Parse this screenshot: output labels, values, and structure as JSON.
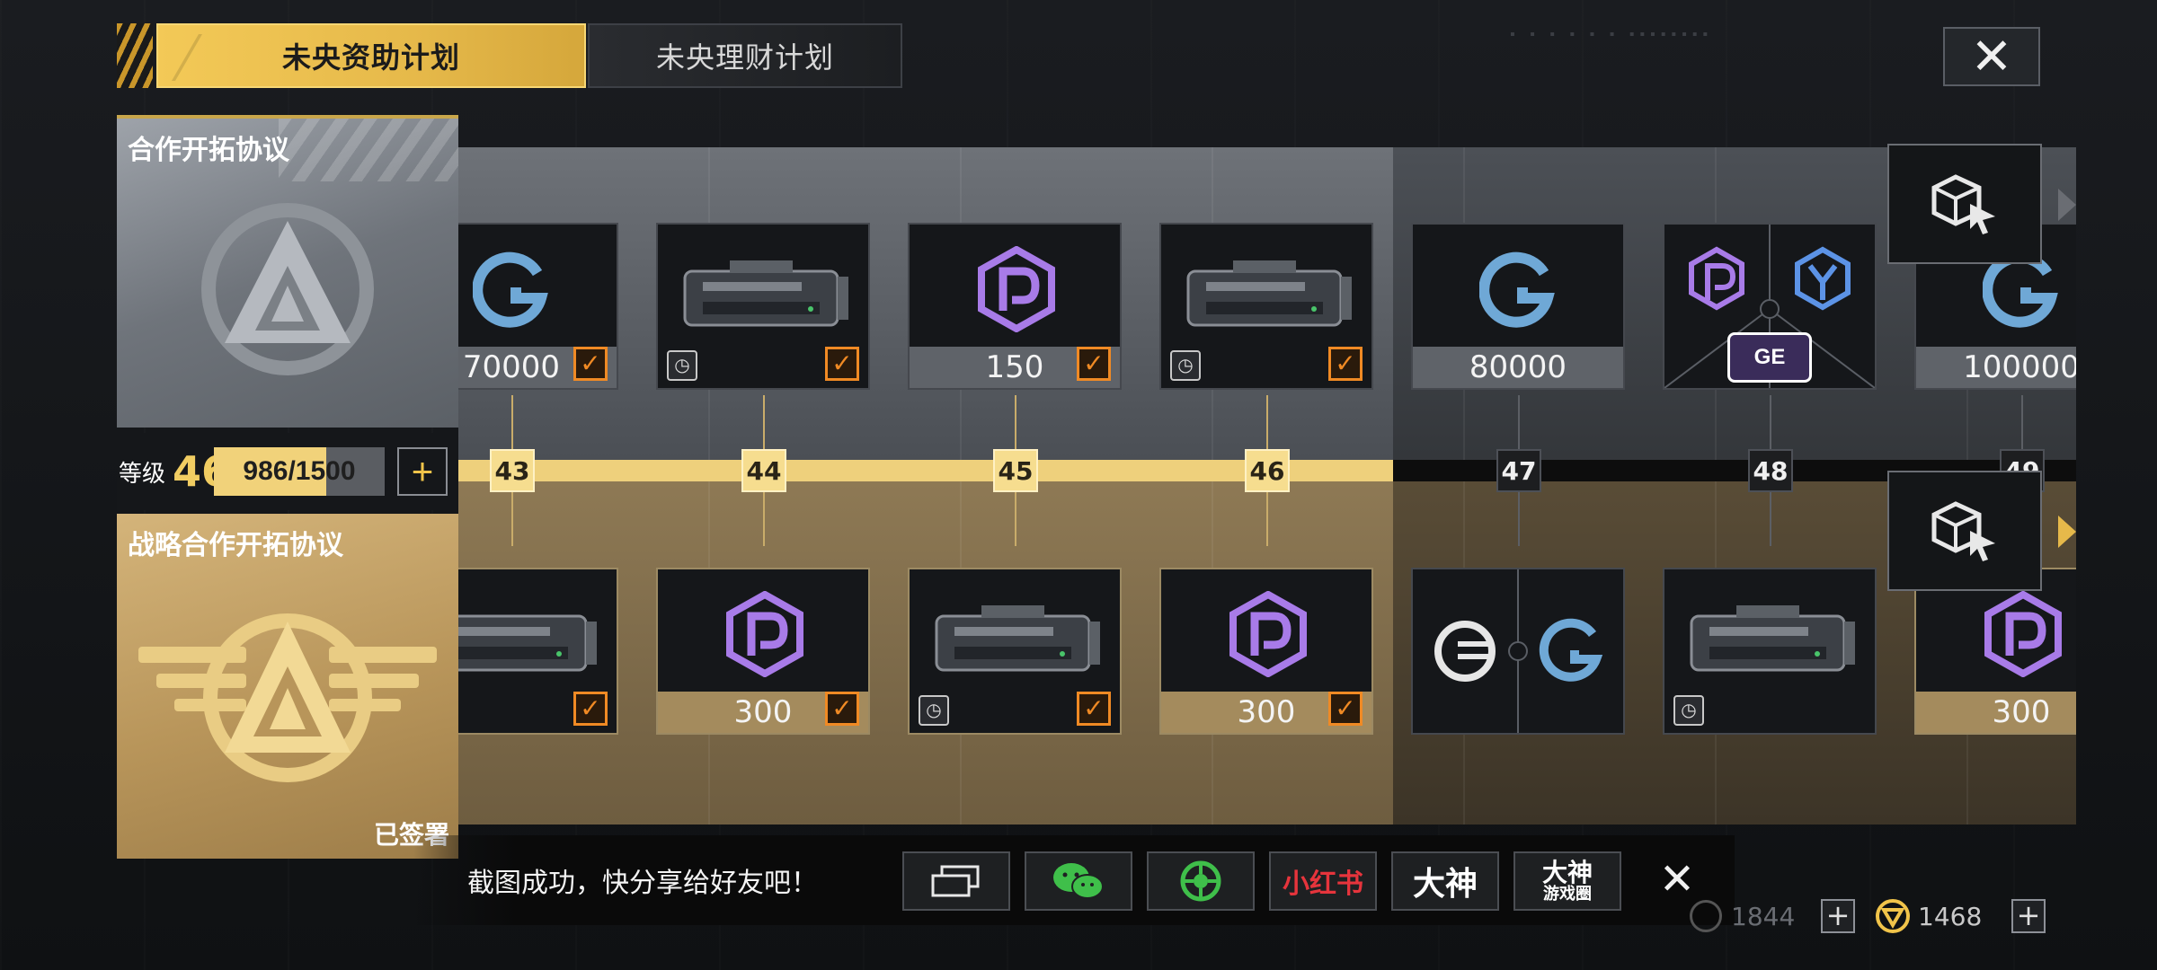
{
  "tabs": [
    {
      "label": "未央资助计划",
      "active": true
    },
    {
      "label": "未央理财计划",
      "active": false
    }
  ],
  "panels": {
    "free_title": "合作开拓协议",
    "premium_title": "战略合作开拓协议",
    "premium_status": "已签署"
  },
  "level": {
    "label": "等级",
    "value": "46",
    "progress_text": "986/1500",
    "progress_fraction": 0.657
  },
  "track": {
    "levels": [
      {
        "num": "43",
        "reached": true
      },
      {
        "num": "44",
        "reached": true
      },
      {
        "num": "45",
        "reached": true
      },
      {
        "num": "46",
        "reached": true
      },
      {
        "num": "47",
        "reached": false
      },
      {
        "num": "48",
        "reached": false
      },
      {
        "num": "49",
        "reached": false
      }
    ],
    "free_rewards": [
      {
        "icon": "coin-c-icon",
        "amount": "70000",
        "claimed": true
      },
      {
        "icon": "weapon-case-icon",
        "amount": "",
        "claimed": true,
        "timed": true
      },
      {
        "icon": "p-coin-icon",
        "amount": "150",
        "claimed": true
      },
      {
        "icon": "weapon-case-icon",
        "amount": "",
        "claimed": true,
        "timed": true
      },
      {
        "icon": "coin-c-icon",
        "amount": "80000",
        "claimed": false
      },
      {
        "icon": "choice-pack-icon",
        "amount": "",
        "claimed": false,
        "badge": "GE"
      },
      {
        "icon": "coin-c-icon",
        "amount": "100000",
        "claimed": false
      }
    ],
    "premium_rewards": [
      {
        "icon": "weapon-case-icon",
        "amount": "",
        "claimed": true
      },
      {
        "icon": "p-coin-icon",
        "amount": "300",
        "claimed": true
      },
      {
        "icon": "weapon-case-icon",
        "amount": "",
        "claimed": true,
        "timed": true
      },
      {
        "icon": "p-coin-icon",
        "amount": "300",
        "claimed": true
      },
      {
        "icon": "dual-coin-icon",
        "amount": "",
        "claimed": false
      },
      {
        "icon": "weapon-case-icon",
        "amount": "",
        "claimed": false,
        "timed": true
      },
      {
        "icon": "p-coin-icon",
        "amount": "300",
        "claimed": false
      }
    ]
  },
  "share": {
    "message": "截图成功，快分享给好友吧！",
    "buttons": [
      "screenshot-icon",
      "wechat-icon",
      "moments-icon",
      "小红书",
      "大神",
      "大神游戏圈"
    ],
    "btn_xhs": "小红书",
    "btn_dashen": "大神",
    "btn_dashen_line1": "大神",
    "btn_dashen_line2": "游戏圈"
  },
  "currency": {
    "primary": "1844",
    "secondary": "1468"
  },
  "colors": {
    "gold": "#f1cd62",
    "accent_orange": "#f08a24",
    "purple": "#a87be8",
    "blue": "#6fa8d6"
  }
}
